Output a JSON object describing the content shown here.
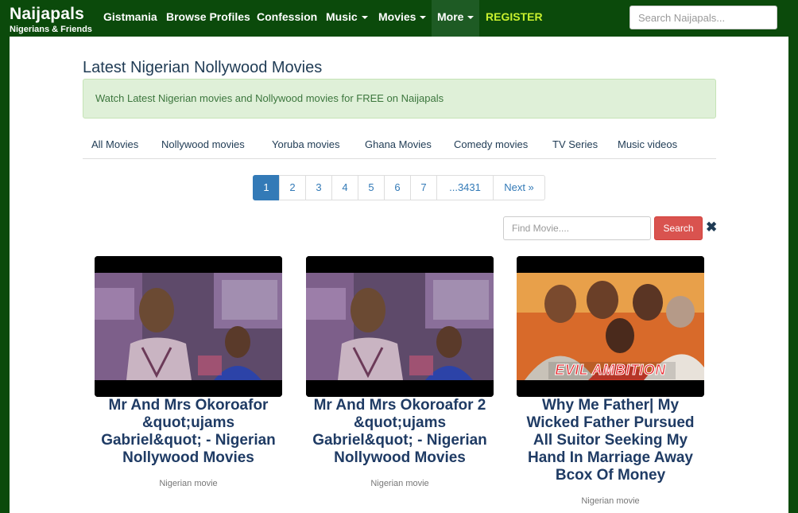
{
  "brand": {
    "name": "Naijapals",
    "tagline": "Nigerians & Friends"
  },
  "nav": {
    "items": [
      {
        "label": "Gistmania"
      },
      {
        "label": "Browse Profiles"
      },
      {
        "label": "Confession"
      },
      {
        "label": "Music"
      },
      {
        "label": "Movies"
      },
      {
        "label": "More"
      },
      {
        "label": "REGISTER"
      }
    ],
    "search_placeholder": "Search Naijapals..."
  },
  "main": {
    "title": "Latest Nigerian Nollywood Movies",
    "notice": "Watch Latest Nigerian movies and Nollywood movies for FREE on Naijapals",
    "tabs": [
      "All Movies",
      "Nollywood movies",
      "Yoruba movies",
      "Ghana Movies",
      "Comedy movies",
      "TV Series",
      "Music videos"
    ],
    "pagination": {
      "pages": [
        "1",
        "2",
        "3",
        "4",
        "5",
        "6",
        "7",
        "...3431"
      ],
      "next": "Next »",
      "current": "1"
    },
    "movie_search": {
      "placeholder": "Find Movie....",
      "button": "Search",
      "clear": "✖"
    },
    "movies": [
      {
        "title": "Mr And Mrs Okoroafor &quot;ujams Gabriel&quot; - Nigerian Nollywood Movies",
        "category": "Nigerian movie"
      },
      {
        "title": "Mr And Mrs Okoroafor 2 &quot;ujams Gabriel&quot; - Nigerian Nollywood Movies",
        "category": "Nigerian movie"
      },
      {
        "title": "Why Me Father| My Wicked Father Pursued All Suitor Seeking My Hand In Marriage Away Bcox Of Money",
        "category": "Nigerian movie",
        "poster_text": "EVIL AMBITION"
      }
    ]
  },
  "colors": {
    "nav_bg": "#0b4a0b",
    "register": "#c8f02e",
    "link": "#337ab7",
    "search_button": "#d9534f",
    "notice_bg": "#dff0d8"
  }
}
